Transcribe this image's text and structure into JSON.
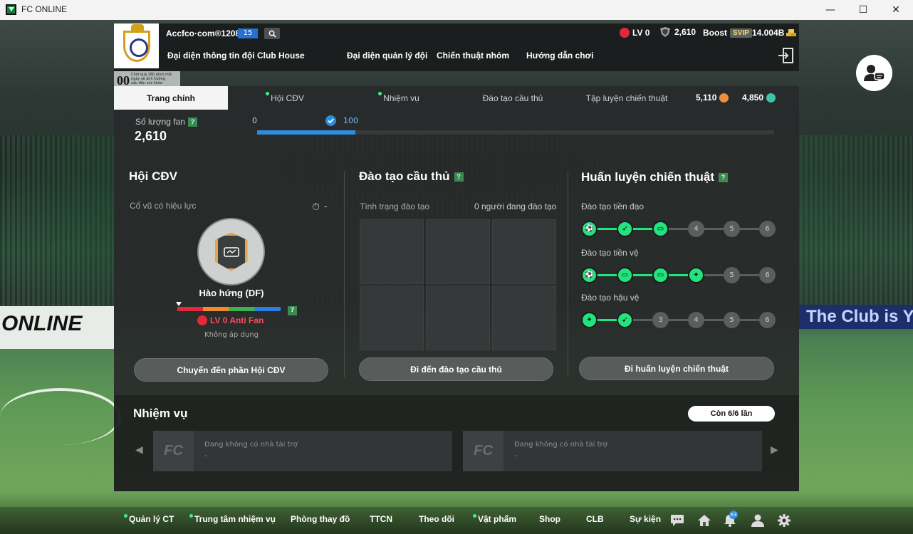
{
  "window": {
    "title": "FC ONLINE",
    "minimize": "—",
    "maximize": "☐",
    "close": "✕"
  },
  "header": {
    "username": "Accfco·com®1208t",
    "level": "15",
    "nav": [
      "Đại diện thông tin đội",
      "Club House",
      "Đại diện quản lý đội",
      "Chiến thuật nhóm",
      "Hướng dẫn chơi"
    ],
    "lv_status": "LV 0",
    "coins": "2,610",
    "boost_label": "Boost",
    "svip": "SVIP",
    "bp": "14.004B"
  },
  "badge": {
    "num": "00",
    "text": "Chơi quá 180 phút mỗi ngày sẽ ảnh hưởng xấu đến sức khỏe"
  },
  "tabs": [
    "Trang chính",
    "Hội CĐV",
    "Nhiệm vụ",
    "Đào tạo cầu thủ",
    "Tập luyện chiến thuật"
  ],
  "currency": {
    "a": "5,110",
    "b": "4,850"
  },
  "fan": {
    "label": "Số lượng fan",
    "help": "?",
    "value": "2,610",
    "min": "0",
    "max": "100",
    "progress": 0.19
  },
  "support": {
    "title": "Hội CĐV",
    "cheer_label": "Cổ vũ có hiệu lực",
    "timer": "-",
    "cheer_name": "Hào hứng (DF)",
    "help": "?",
    "anti_fan": "LV 0 Anti Fan",
    "not_applied": "Không áp dụng",
    "button": "Chuyển đến phần Hội CĐV"
  },
  "training": {
    "title": "Đào tạo cầu thủ",
    "help": "?",
    "status": "Tình trạng đào tạo",
    "count": "0 người đang đào tạo",
    "button": "Đi đến đào tạo cầu thủ"
  },
  "tactic": {
    "title": "Huấn luyện chiến thuật",
    "help": "?",
    "rows": [
      {
        "label": "Đào tạo tiền đạo",
        "nodes": [
          {
            "on": true,
            "t": "⚽"
          },
          {
            "on": true,
            "t": "➶"
          },
          {
            "on": true,
            "t": "▭"
          },
          {
            "on": false,
            "t": "4"
          },
          {
            "on": false,
            "t": "5"
          },
          {
            "on": false,
            "t": "6"
          }
        ]
      },
      {
        "label": "Đào tạo tiền vệ",
        "nodes": [
          {
            "on": true,
            "t": "⚽"
          },
          {
            "on": true,
            "t": "▭"
          },
          {
            "on": true,
            "t": "▭"
          },
          {
            "on": true,
            "t": "✦"
          },
          {
            "on": false,
            "t": "5"
          },
          {
            "on": false,
            "t": "6"
          }
        ]
      },
      {
        "label": "Đào tạo hậu vệ",
        "nodes": [
          {
            "on": true,
            "t": "✦"
          },
          {
            "on": true,
            "t": "➹"
          },
          {
            "on": false,
            "t": "3"
          },
          {
            "on": false,
            "t": "4"
          },
          {
            "on": false,
            "t": "5"
          },
          {
            "on": false,
            "t": "6"
          }
        ]
      }
    ],
    "button": "Đi huấn luyện chiến thuật"
  },
  "missions": {
    "title": "Nhiệm vụ",
    "remaining": "Còn 6/6 lần",
    "cards": [
      {
        "logo": "FC",
        "text": "Đang không có nhà tài trợ",
        "sub": "-"
      },
      {
        "logo": "FC",
        "text": "Đang không có nhà tài trợ",
        "sub": "-"
      }
    ]
  },
  "bottom": {
    "items": [
      "Quản lý CT",
      "Trung tâm nhiệm vụ",
      "Phòng thay đồ",
      "TTCN",
      "Theo dõi",
      "Vật phẩm",
      "Shop",
      "CLB",
      "Sự kiện"
    ],
    "notif": "63"
  },
  "scene": {
    "banner_left": "ONLINE",
    "banner_right": "The Club is Y"
  }
}
